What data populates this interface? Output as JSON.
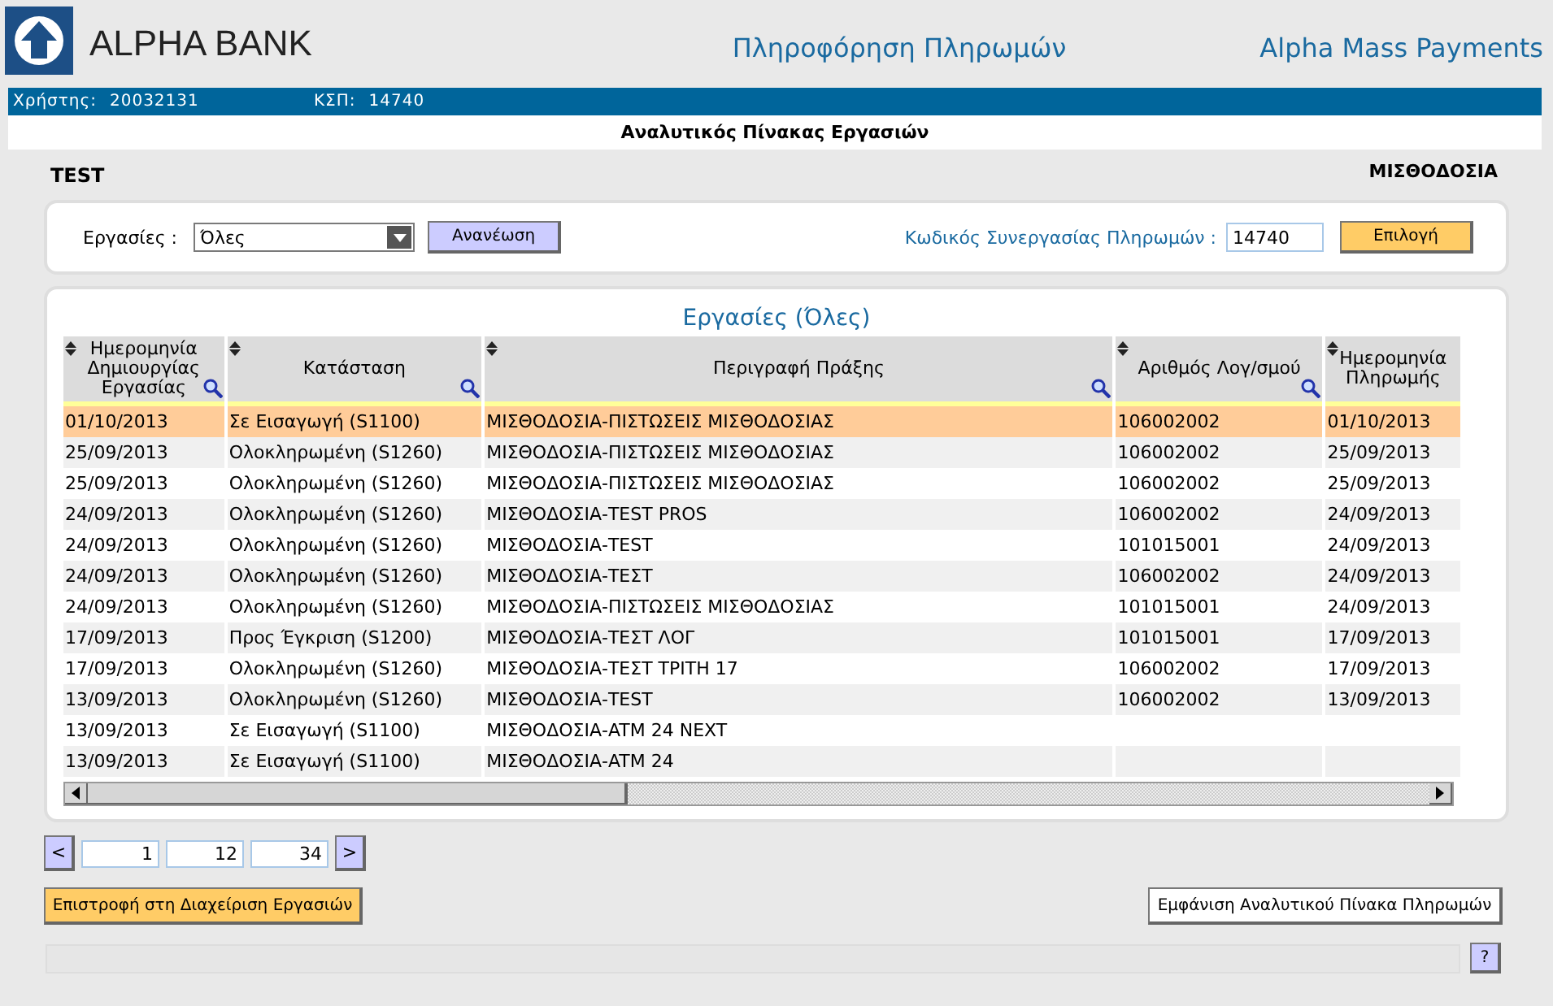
{
  "header": {
    "logo_text": "ALPHA BANK",
    "page_title": "Πληροφόρηση Πληρωμών",
    "app_name": "Alpha Mass Payments"
  },
  "user_bar": {
    "user_label": "Χρήστης:",
    "user_value": "20032131",
    "ksp_label": "ΚΣΠ:",
    "ksp_value": "14740"
  },
  "screen_title": "Αναλυτικός Πίνακας Εργασιών",
  "context": {
    "left": "TEST",
    "right": "ΜΙΣΘΟΔΟΣΙΑ"
  },
  "filter": {
    "jobs_label": "Εργασίες :",
    "jobs_value": "Όλες",
    "refresh_button": "Ανανέωση",
    "code_label": "Κωδικός Συνεργασίας Πληρωμών :",
    "code_value": "14740",
    "select_button": "Επιλογή"
  },
  "table": {
    "title": "Εργασίες (Όλες)",
    "columns": [
      {
        "label": "Ημερομηνία Δημιουργίας Εργασίας",
        "searchable": true
      },
      {
        "label": "Κατάσταση",
        "searchable": true
      },
      {
        "label": "Περιγραφή Πράξης",
        "searchable": true
      },
      {
        "label": "Αριθμός Λογ/σμού",
        "searchable": true
      },
      {
        "label": "Ημερομηνία Πληρωμής",
        "searchable": false
      }
    ],
    "rows": [
      {
        "selected": true,
        "cells": [
          "01/10/2013",
          "Σε Εισαγωγή (S1100)",
          "ΜΙΣΘΟΔΟΣΙΑ-ΠΙΣΤΩΣΕΙΣ ΜΙΣΘΟΔΟΣΙΑΣ",
          "106002002",
          "01/10/2013"
        ]
      },
      {
        "selected": false,
        "cells": [
          "25/09/2013",
          "Ολοκληρωμένη (S1260)",
          "ΜΙΣΘΟΔΟΣΙΑ-ΠΙΣΤΩΣΕΙΣ ΜΙΣΘΟΔΟΣΙΑΣ",
          "106002002",
          "25/09/2013"
        ]
      },
      {
        "selected": false,
        "cells": [
          "25/09/2013",
          "Ολοκληρωμένη (S1260)",
          "ΜΙΣΘΟΔΟΣΙΑ-ΠΙΣΤΩΣΕΙΣ ΜΙΣΘΟΔΟΣΙΑΣ",
          "106002002",
          "25/09/2013"
        ]
      },
      {
        "selected": false,
        "cells": [
          "24/09/2013",
          "Ολοκληρωμένη (S1260)",
          "ΜΙΣΘΟΔΟΣΙΑ-TEST PROS",
          "106002002",
          "24/09/2013"
        ]
      },
      {
        "selected": false,
        "cells": [
          "24/09/2013",
          "Ολοκληρωμένη (S1260)",
          "ΜΙΣΘΟΔΟΣΙΑ-TEST",
          "101015001",
          "24/09/2013"
        ]
      },
      {
        "selected": false,
        "cells": [
          "24/09/2013",
          "Ολοκληρωμένη (S1260)",
          "ΜΙΣΘΟΔΟΣΙΑ-ΤΕΣΤ",
          "106002002",
          "24/09/2013"
        ]
      },
      {
        "selected": false,
        "cells": [
          "24/09/2013",
          "Ολοκληρωμένη (S1260)",
          "ΜΙΣΘΟΔΟΣΙΑ-ΠΙΣΤΩΣΕΙΣ ΜΙΣΘΟΔΟΣΙΑΣ",
          "101015001",
          "24/09/2013"
        ]
      },
      {
        "selected": false,
        "cells": [
          "17/09/2013",
          "Προς Έγκριση (S1200)",
          "ΜΙΣΘΟΔΟΣΙΑ-ΤΕΣΤ ΛΟΓ",
          "101015001",
          "17/09/2013"
        ]
      },
      {
        "selected": false,
        "cells": [
          "17/09/2013",
          "Ολοκληρωμένη (S1260)",
          "ΜΙΣΘΟΔΟΣΙΑ-ΤΕΣΤ ΤΡΙΤΗ 17",
          "106002002",
          "17/09/2013"
        ]
      },
      {
        "selected": false,
        "cells": [
          "13/09/2013",
          "Ολοκληρωμένη (S1260)",
          "ΜΙΣΘΟΔΟΣΙΑ-TEST",
          "106002002",
          "13/09/2013"
        ]
      },
      {
        "selected": false,
        "cells": [
          "13/09/2013",
          "Σε Εισαγωγή (S1100)",
          "ΜΙΣΘΟΔΟΣΙΑ-ATM 24 NEXT"
        ]
      },
      {
        "selected": false,
        "cells": [
          "13/09/2013",
          "Σε Εισαγωγή (S1100)",
          "ΜΙΣΘΟΔΟΣΙΑ-ATM 24"
        ]
      }
    ]
  },
  "pagination": {
    "prev": "<",
    "fields": [
      "1",
      "12",
      "34"
    ],
    "next": ">"
  },
  "buttons": {
    "back": "Επιστροφή στη Διαχείριση Εργασιών",
    "show_payments": "Εμφάνιση Αναλυτικού Πίνακα Πληρωμών"
  },
  "help": "?"
}
